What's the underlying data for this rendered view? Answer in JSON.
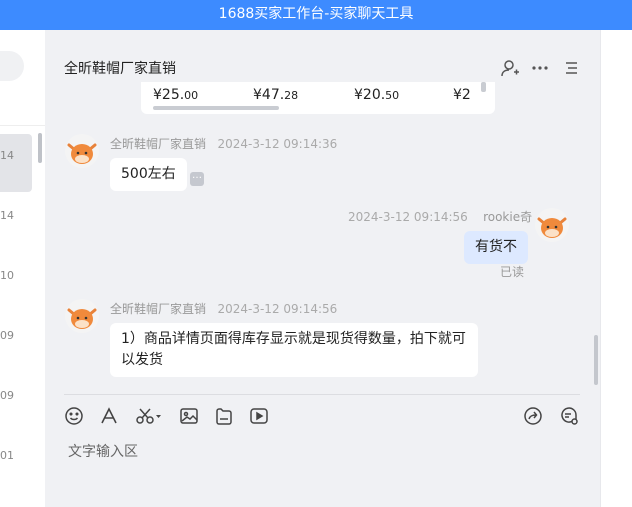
{
  "window": {
    "title": "1688买家工作台-买家聊天工具"
  },
  "left_list": {
    "times": [
      "14",
      "14",
      "10",
      "09",
      "09",
      "01"
    ]
  },
  "chat": {
    "title": "全昕鞋帽厂家直销",
    "header_icons": [
      "add-contact-icon",
      "more-icon",
      "menu-icon"
    ]
  },
  "product_card": {
    "prices": [
      {
        "main": "¥25.",
        "cents": "00"
      },
      {
        "main": "¥47.",
        "cents": "28"
      },
      {
        "main": "¥20.",
        "cents": "50"
      },
      {
        "main": "¥2",
        "cents": ""
      }
    ]
  },
  "messages": [
    {
      "sender": "全昕鞋帽厂家直销",
      "time": "2024-3-12 09:14:36",
      "text": "500左右",
      "side": "left"
    },
    {
      "sender": "rookie奇",
      "time": "2024-3-12 09:14:56",
      "text": "有货不",
      "side": "right",
      "status": "已读"
    },
    {
      "sender": "全昕鞋帽厂家直销",
      "time": "2024-3-12 09:14:56",
      "text": "1）商品详情页面得库存显示就是现货得数量，拍下就可以发货",
      "side": "left"
    }
  ],
  "toolbar": {
    "icons": [
      "emoji-icon",
      "font-icon",
      "scissors-icon",
      "image-icon",
      "file-icon",
      "video-icon",
      "share-icon",
      "quick-reply-icon"
    ]
  },
  "input": {
    "placeholder": "文字输入区"
  },
  "colors": {
    "titlebar": "#3d8bff",
    "my_bubble": "#dde9ff"
  }
}
